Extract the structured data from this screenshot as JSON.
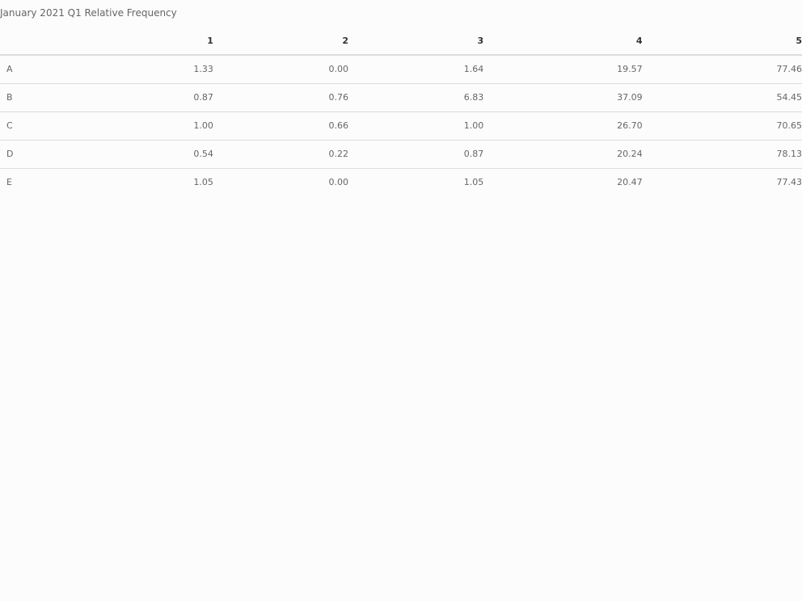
{
  "caption": "January 2021 Q1 Relative Frequency",
  "table": {
    "columns": [
      "",
      "1",
      "2",
      "3",
      "4",
      "5"
    ],
    "rows": [
      {
        "label": "A",
        "values": [
          "1.33",
          "0.00",
          "1.64",
          "19.57",
          "77.46"
        ]
      },
      {
        "label": "B",
        "values": [
          "0.87",
          "0.76",
          "6.83",
          "37.09",
          "54.45"
        ]
      },
      {
        "label": "C",
        "values": [
          "1.00",
          "0.66",
          "1.00",
          "26.70",
          "70.65"
        ]
      },
      {
        "label": "D",
        "values": [
          "0.54",
          "0.22",
          "0.87",
          "20.24",
          "78.13"
        ]
      },
      {
        "label": "E",
        "values": [
          "1.05",
          "0.00",
          "1.05",
          "20.47",
          "77.43"
        ]
      }
    ]
  }
}
